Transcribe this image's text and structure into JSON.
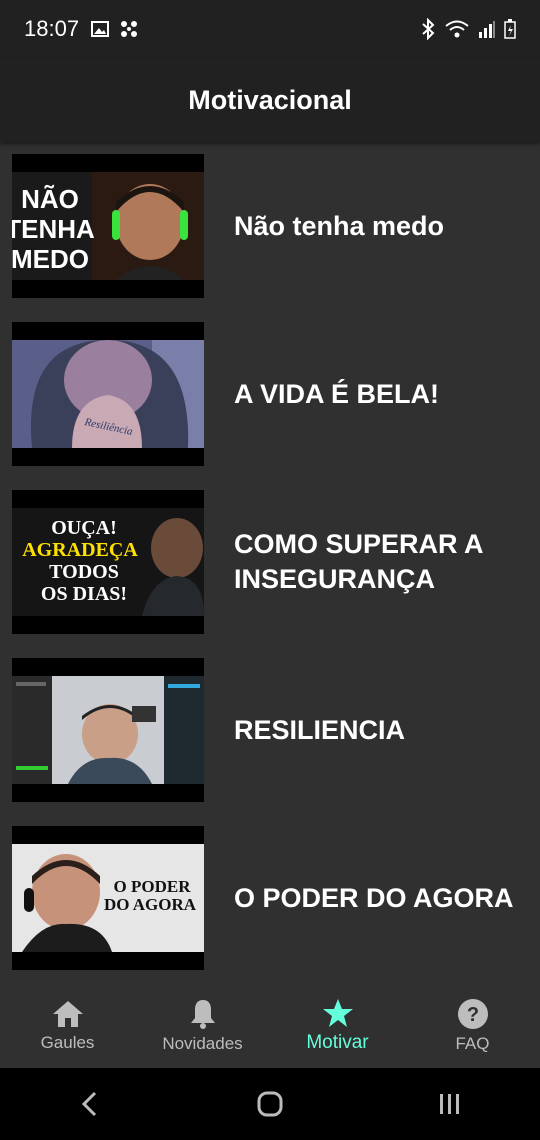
{
  "status_bar": {
    "time": "18:07"
  },
  "app_bar": {
    "title": "Motivacional"
  },
  "videos": [
    {
      "title": "Não tenha medo",
      "thumb_text": [
        "NÃO",
        "TENHA",
        "MEDO"
      ]
    },
    {
      "title": "A VIDA É BELA!",
      "thumb_text": [
        "Resiliência"
      ]
    },
    {
      "title": "COMO SUPERAR A INSEGURANÇA",
      "thumb_text": [
        "OUÇA!",
        "AGRADEÇA",
        "TODOS",
        "OS DIAS!"
      ]
    },
    {
      "title": "RESILIENCIA",
      "thumb_text": []
    },
    {
      "title": "O PODER DO AGORA",
      "thumb_text": [
        "O PODER",
        "DO AGORA"
      ]
    }
  ],
  "bottom_nav": [
    {
      "label": "Gaules",
      "icon": "home-icon",
      "active": false
    },
    {
      "label": "Novidades",
      "icon": "bell-icon",
      "active": false
    },
    {
      "label": "Motivar",
      "icon": "star-icon",
      "active": true
    },
    {
      "label": "FAQ",
      "icon": "help-icon",
      "active": false
    }
  ],
  "colors": {
    "accent": "#64ffda",
    "background": "#303030",
    "bar": "#212121"
  }
}
